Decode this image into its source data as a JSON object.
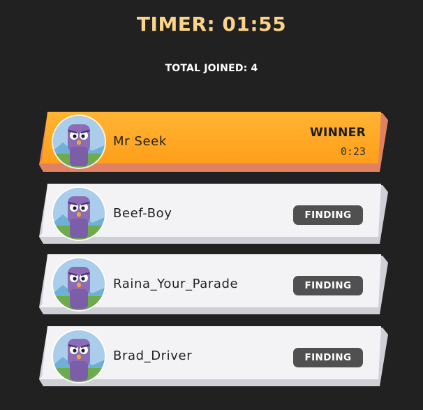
{
  "header": {
    "timer_text": "TIMER: 01:55",
    "total_joined_text": "TOTAL JOINED: 4"
  },
  "players": [
    {
      "name": "Mr Seek",
      "status": "WINNER",
      "time": "0:23",
      "highlight": true
    },
    {
      "name": "Beef-Boy",
      "status": "FINDING",
      "highlight": false
    },
    {
      "name": "Raina_Your_Parade",
      "status": "FINDING",
      "highlight": false
    },
    {
      "name": "Brad_Driver",
      "status": "FINDING",
      "highlight": false
    }
  ],
  "colors": {
    "background": "#212121",
    "timer": "#fbd38a",
    "winner_card": "#ffa726",
    "card": "#f2f2f4",
    "badge": "#505050"
  },
  "icons": {
    "avatar": "purple-owl-avatar-icon"
  }
}
